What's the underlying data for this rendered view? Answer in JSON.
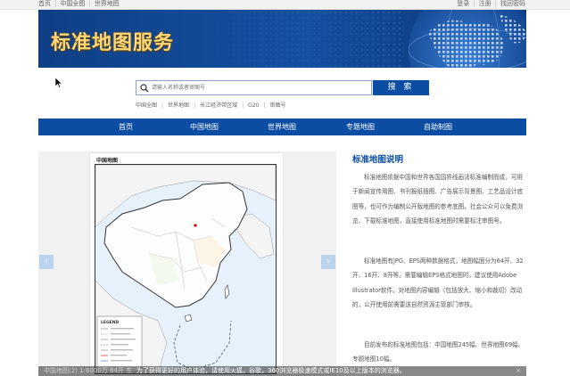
{
  "topbar": {
    "left_links": [
      "首页",
      "中国全图",
      "世界地图"
    ],
    "right_links": [
      "登录",
      "注册",
      "找回密码"
    ]
  },
  "banner": {
    "title": "标准地图服务"
  },
  "search": {
    "placeholder": "请输入名称或者审图号",
    "button_label": "搜 索",
    "quick_links": [
      "中国全图",
      "世界地图",
      "长江经济带区域",
      "G20",
      "审图号"
    ]
  },
  "nav": {
    "items": [
      "首页",
      "中国地图",
      "世界地图",
      "专题地图",
      "自助制图"
    ]
  },
  "slider": {
    "prev_icon": "‹",
    "next_icon": "›",
    "map_title": "中国地图",
    "map_legend_title": "LEGEND",
    "caption_left": "中国地图(2) 1:6000万 64开 东",
    "caption_notice": "为了获得更好的用户体验，请使用火狐，谷歌，360浏览器极速模式或IE10及以上版本的浏览器。",
    "close_icon": "×"
  },
  "description": {
    "title": "标准地图说明",
    "paragraphs": [
      "标准地图依据中国和世界各国国界线画法标准编制而成，可用于新闻宣传用图、书刊报纸插图、广告展示背景图、工艺品设计底图等，也可作为编制公开版地图的参考底图。社会公众可以免费浏览、下载标准地图，直接使用标准地图时需要标注审图号。",
      "标准地图有JPG、EPS两种数据格式，地图幅面分为64开、32开、16开、8开等。需要编辑EPS格式地图时，建议使用Adobe Illustrator软件。对地图内容编辑（包括放大、缩小和裁切）改动的，公开使用前需要送自然资源主管部门审核。",
      "目前发布的标准地图包括：中国地图245幅、世界地图69幅、专题地图10幅。"
    ]
  },
  "colors": {
    "brand_blue": "#0b4da2",
    "banner_title": "#ffd87a",
    "link_blue": "#0b4da2"
  }
}
